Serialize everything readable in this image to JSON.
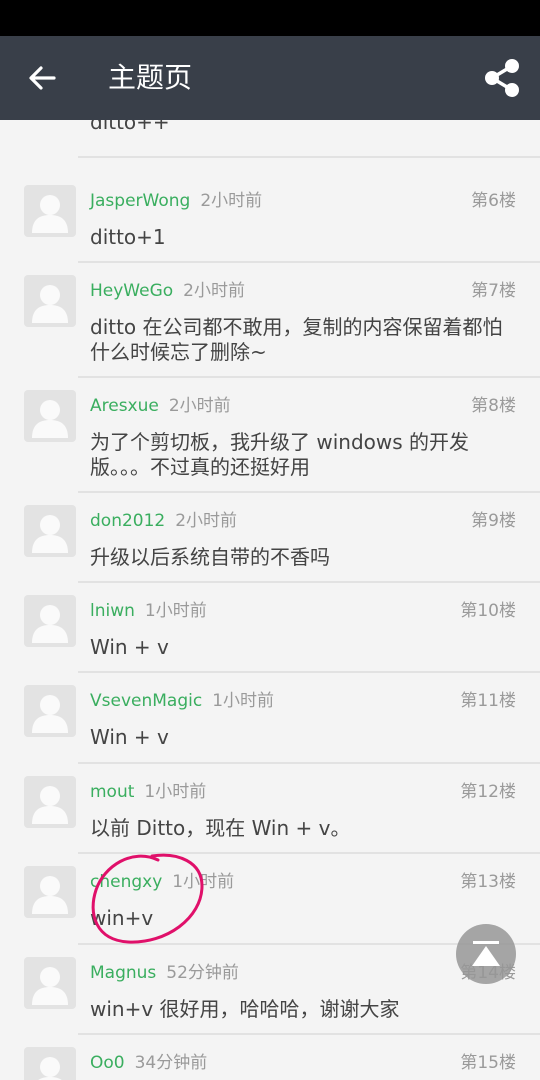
{
  "app_bar": {
    "title": "主题页",
    "back_icon": "arrow-left-icon",
    "share_icon": "share-icon"
  },
  "partial_reply": {
    "content": "ditto++"
  },
  "replies": [
    {
      "user": "JasperWong",
      "time": "2小时前",
      "floor": "第6楼",
      "content": "ditto+1"
    },
    {
      "user": "HeyWeGo",
      "time": "2小时前",
      "floor": "第7楼",
      "content": "ditto 在公司都不敢用，复制的内容保留着都怕什么时候忘了删除~"
    },
    {
      "user": "Aresxue",
      "time": "2小时前",
      "floor": "第8楼",
      "content": "为了个剪切板，我升级了 windows 的开发版。。。不过真的还挺好用"
    },
    {
      "user": "don2012",
      "time": "2小时前",
      "floor": "第9楼",
      "content": "升级以后系统自带的不香吗"
    },
    {
      "user": "lniwn",
      "time": "1小时前",
      "floor": "第10楼",
      "content": "Win + v"
    },
    {
      "user": "VsevenMagic",
      "time": "1小时前",
      "floor": "第11楼",
      "content": "Win + v"
    },
    {
      "user": "mout",
      "time": "1小时前",
      "floor": "第12楼",
      "content": "以前 Ditto，现在 Win + v。"
    },
    {
      "user": "chengxy",
      "time": "1小时前",
      "floor": "第13楼",
      "content": "win+v"
    },
    {
      "user": "Magnus",
      "time": "52分钟前",
      "floor": "第14楼",
      "content": "win+v 很好用，哈哈哈，谢谢大家"
    },
    {
      "user": "Oo0",
      "time": "34分钟前",
      "floor": "第15楼",
      "content": ""
    }
  ],
  "fab": {
    "icon": "scroll-to-top-icon"
  },
  "colors": {
    "app_bar": "#393f49",
    "username": "#3aae5f",
    "annotation": "#e0106a"
  }
}
